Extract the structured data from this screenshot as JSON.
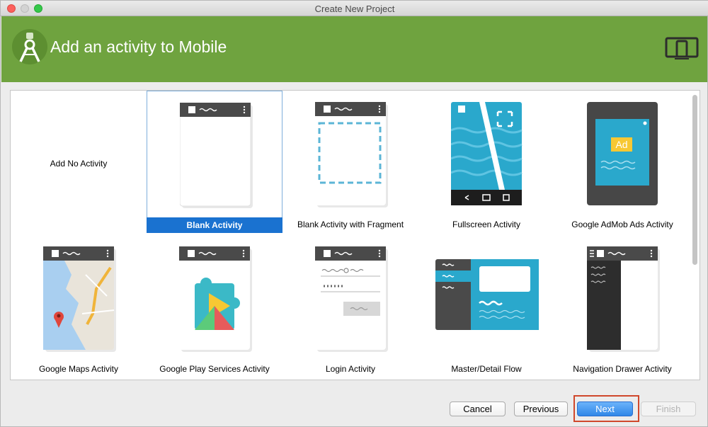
{
  "window": {
    "title": "Create New Project"
  },
  "header": {
    "title": "Add an activity to Mobile"
  },
  "activities": [
    {
      "label": "Add No Activity",
      "selected": false,
      "kind": "none"
    },
    {
      "label": "Blank Activity",
      "selected": true,
      "kind": "blank"
    },
    {
      "label": "Blank Activity with Fragment",
      "selected": false,
      "kind": "fragment"
    },
    {
      "label": "Fullscreen Activity",
      "selected": false,
      "kind": "fullscreen"
    },
    {
      "label": "Google AdMob Ads Activity",
      "selected": false,
      "kind": "admob",
      "ad_text": "Ad"
    },
    {
      "label": "Google Maps Activity",
      "selected": false,
      "kind": "maps"
    },
    {
      "label": "Google Play Services Activity",
      "selected": false,
      "kind": "play"
    },
    {
      "label": "Login Activity",
      "selected": false,
      "kind": "login"
    },
    {
      "label": "Master/Detail Flow",
      "selected": false,
      "kind": "master"
    },
    {
      "label": "Navigation Drawer Activity",
      "selected": false,
      "kind": "drawer"
    }
  ],
  "buttons": {
    "cancel": "Cancel",
    "previous": "Previous",
    "next": "Next",
    "finish": "Finish"
  },
  "colors": {
    "header": "#6fa33f",
    "selection": "#1a72d0",
    "highlight": "#d0482c",
    "thumb_teal": "#2aa8cc"
  }
}
